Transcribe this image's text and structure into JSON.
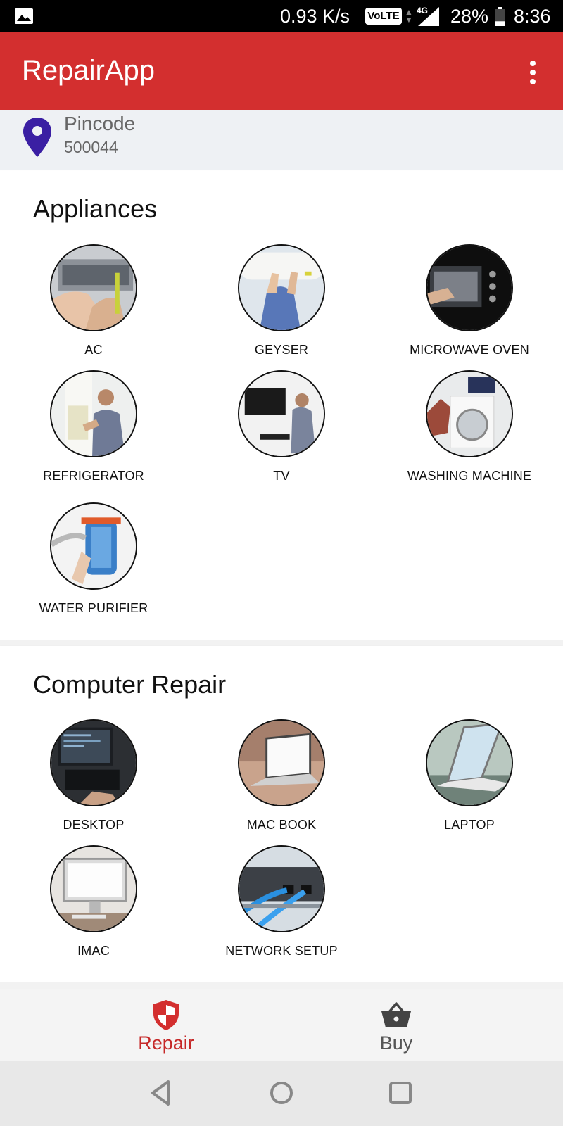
{
  "status_bar": {
    "icon": "gallery-icon",
    "network_speed": "0.93 K/s",
    "volte": "VoLTE",
    "network_type": "4G",
    "battery_percent": "28%",
    "battery_level": 0.28,
    "time": "8:36"
  },
  "app_bar": {
    "title": "RepairApp",
    "menu_icon": "more-vert-icon"
  },
  "location": {
    "icon": "location-pin-icon",
    "label": "Pincode",
    "value": "500044",
    "icon_color": "#3a1fa3"
  },
  "sections": [
    {
      "title": "Appliances",
      "items": [
        {
          "label": "AC"
        },
        {
          "label": "GEYSER"
        },
        {
          "label": "MICROWAVE OVEN"
        },
        {
          "label": "REFRIGERATOR"
        },
        {
          "label": "TV"
        },
        {
          "label": "WASHING MACHINE"
        },
        {
          "label": "WATER PURIFIER"
        }
      ]
    },
    {
      "title": "Computer Repair",
      "items": [
        {
          "label": "DESKTOP"
        },
        {
          "label": "MAC BOOK"
        },
        {
          "label": "LAPTOP"
        },
        {
          "label": "IMAC"
        },
        {
          "label": "NETWORK SETUP"
        }
      ]
    }
  ],
  "bottom_nav": {
    "items": [
      {
        "label": "Repair",
        "icon": "shield-icon",
        "active": true
      },
      {
        "label": "Buy",
        "icon": "basket-icon",
        "active": false
      }
    ]
  },
  "system_nav": {
    "back": "back-icon",
    "home": "home-icon",
    "recents": "recents-icon"
  },
  "colors": {
    "accent": "#d32f2f",
    "active_nav": "#c62828",
    "pin": "#3a1fa3"
  }
}
